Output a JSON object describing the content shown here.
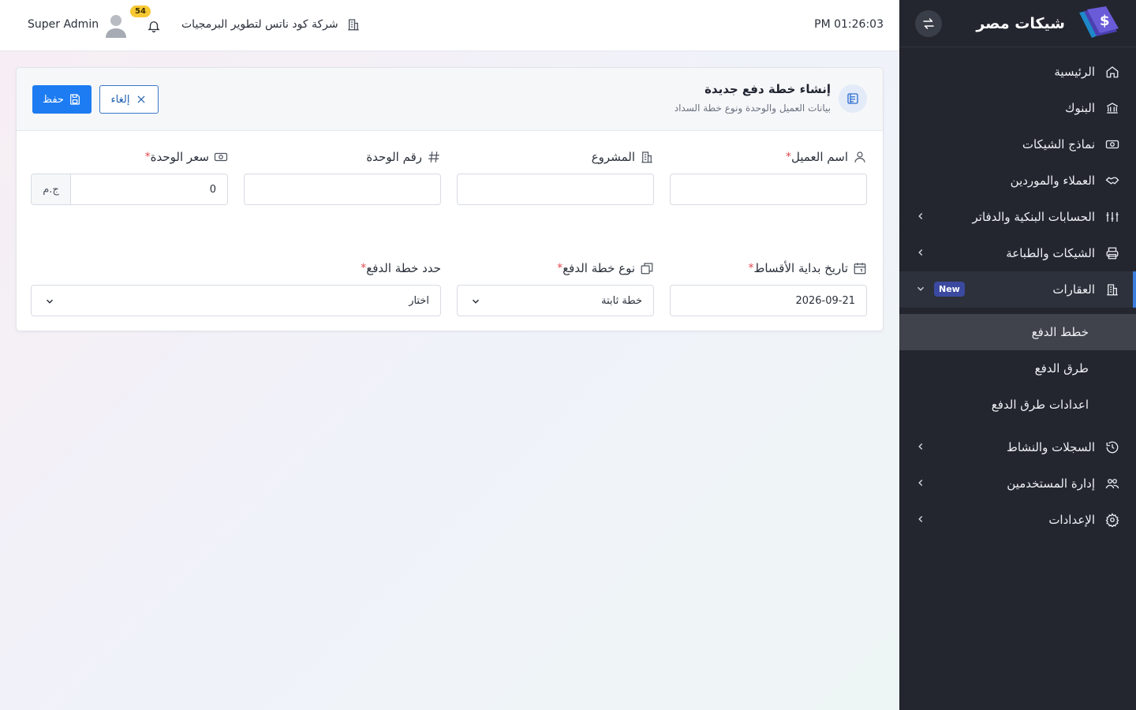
{
  "sidebar": {
    "brand_title": "شيكات مصر",
    "items": [
      {
        "label": "الرئيسية"
      },
      {
        "label": "البنوك"
      },
      {
        "label": "نماذج الشيكات"
      },
      {
        "label": "العملاء والموردين"
      },
      {
        "label": "الحسابات البنكية والدفاتر"
      },
      {
        "label": "الشيكات والطباعة"
      },
      {
        "label": "العقارات",
        "badge": "New"
      },
      {
        "label": "السجلات والنشاط"
      },
      {
        "label": "إدارة المستخدمين"
      },
      {
        "label": "الإعدادات"
      }
    ],
    "submenu": [
      {
        "label": "خطط الدفع"
      },
      {
        "label": "طرق الدفع"
      },
      {
        "label": "اعدادات طرق الدفع"
      }
    ]
  },
  "header": {
    "clock": "PM 01:26:03",
    "company": "شركة كود ناتس لتطوير البرمجيات",
    "notif_count": "54",
    "username": "Super Admin"
  },
  "card": {
    "title": "إنشاء خطة دفع جديدة",
    "subtitle": "بيانات العميل والوحدة ونوع خطة السداد",
    "save_label": "حفظ",
    "cancel_label": "إلغاء"
  },
  "form": {
    "client_name": {
      "label": "اسم العميل",
      "required": "*",
      "value": ""
    },
    "project": {
      "label": "المشروع",
      "value": ""
    },
    "unit_number": {
      "label": "رقم الوحدة",
      "value": ""
    },
    "unit_price": {
      "label": "سعر الوحدة",
      "required": "*",
      "value": "0",
      "suffix": "ج.م"
    },
    "start_date": {
      "label": "تاريخ بداية الأقساط",
      "required": "*",
      "value": "2026-09-21"
    },
    "plan_type": {
      "label": "نوع خطة الدفع",
      "required": "*",
      "value": "خطة ثابتة"
    },
    "plan_select": {
      "label": "حدد خطة الدفع",
      "required": "*",
      "value": "اختار"
    }
  },
  "colors": {
    "primary": "#1d7cf2",
    "sidebar_bg": "#23262f",
    "accent": "#3b7ddd",
    "required": "#e5484d",
    "badge": "#f7c832"
  }
}
